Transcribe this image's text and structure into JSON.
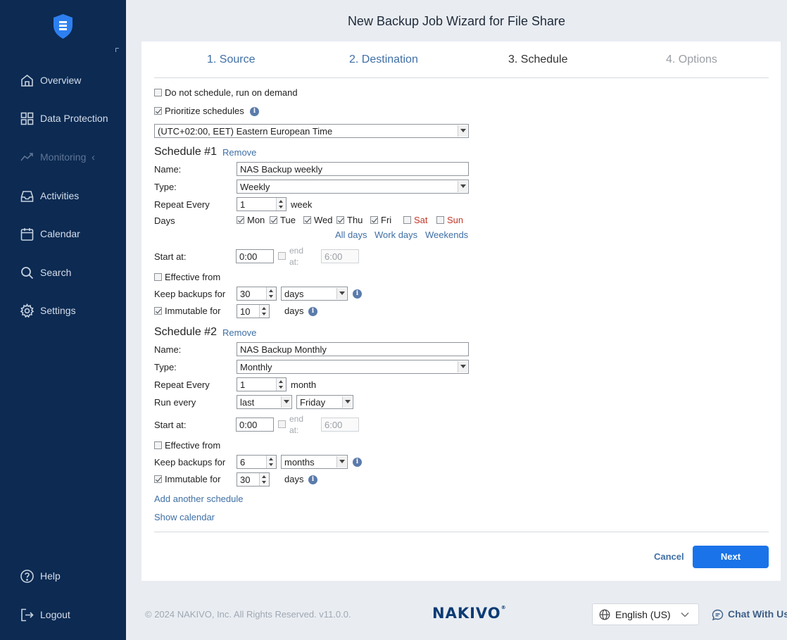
{
  "wizard": {
    "title": "New Backup Job Wizard for File Share"
  },
  "sidebar": {
    "items": [
      {
        "label": "Overview",
        "icon": "home-icon"
      },
      {
        "label": "Data Protection",
        "icon": "grid-icon"
      },
      {
        "label": "Monitoring",
        "icon": "trend-icon",
        "disabled": true
      },
      {
        "label": "Activities",
        "icon": "inbox-icon"
      },
      {
        "label": "Calendar",
        "icon": "calendar-icon"
      },
      {
        "label": "Search",
        "icon": "search-icon"
      },
      {
        "label": "Settings",
        "icon": "gear-icon"
      }
    ],
    "bottom": [
      {
        "label": "Help",
        "icon": "help-icon"
      },
      {
        "label": "Logout",
        "icon": "logout-icon"
      }
    ]
  },
  "steps": [
    "1. Source",
    "2. Destination",
    "3. Schedule",
    "4. Options"
  ],
  "general": {
    "no_schedule_label": "Do not schedule, run on demand",
    "no_schedule_checked": false,
    "prioritize_label": "Prioritize schedules",
    "prioritize_checked": true,
    "timezone": "(UTC+02:00, EET) Eastern European Time"
  },
  "labels": {
    "name": "Name:",
    "type": "Type:",
    "repeat_every": "Repeat Every",
    "days": "Days",
    "run_every": "Run every",
    "start_at": "Start at:",
    "end_at": "end at:",
    "effective_from": "Effective from",
    "keep_backups_for": "Keep backups for",
    "immutable_for": "Immutable for",
    "remove": "Remove",
    "days_unit": "days",
    "all_days": "All days",
    "work_days": "Work days",
    "weekends": "Weekends"
  },
  "schedule1": {
    "heading": "Schedule #1",
    "name": "NAS Backup weekly",
    "type": "Weekly",
    "repeat_value": "1",
    "repeat_unit": "week",
    "days": [
      {
        "label": "Mon",
        "checked": true
      },
      {
        "label": "Tue",
        "checked": true
      },
      {
        "label": "Wed",
        "checked": true
      },
      {
        "label": "Thu",
        "checked": true
      },
      {
        "label": "Fri",
        "checked": true
      },
      {
        "label": "Sat",
        "checked": false
      },
      {
        "label": "Sun",
        "checked": false
      }
    ],
    "start_at": "0:00",
    "end_at": "6:00",
    "keep_value": "30",
    "keep_unit": "days",
    "immutable_value": "10"
  },
  "schedule2": {
    "heading": "Schedule #2",
    "name": "NAS Backup Monthly",
    "type": "Monthly",
    "repeat_value": "1",
    "repeat_unit": "month",
    "run_every_ordinal": "last",
    "run_every_day": "Friday",
    "start_at": "0:00",
    "end_at": "6:00",
    "keep_value": "6",
    "keep_unit": "months",
    "immutable_value": "30"
  },
  "links": {
    "add_schedule": "Add another schedule",
    "show_calendar": "Show calendar"
  },
  "buttons": {
    "cancel": "Cancel",
    "next": "Next"
  },
  "footer": {
    "copyright": "© 2024 NAKIVO, Inc. All Rights Reserved. v11.0.0.",
    "brand": "NAKIVO",
    "language": "English (US)",
    "chat": "Chat With Us"
  },
  "colors": {
    "sidebar_bg": "#0c2a52",
    "accent": "#1a73e8",
    "link": "#3f6fa6",
    "weekend_red": "#c0392b"
  }
}
